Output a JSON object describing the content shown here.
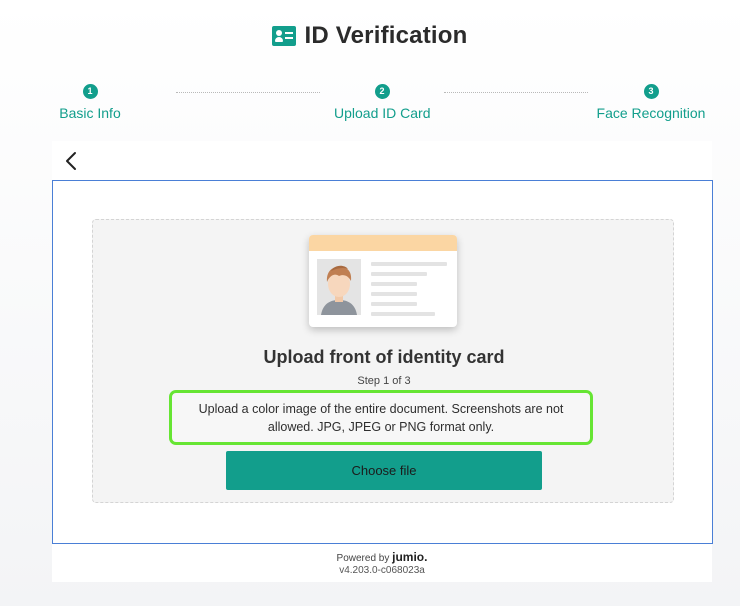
{
  "header": {
    "title": "ID Verification",
    "icon": "id-card-icon"
  },
  "stepper": {
    "steps": [
      {
        "number": "1",
        "label": "Basic Info"
      },
      {
        "number": "2",
        "label": "Upload ID Card"
      },
      {
        "number": "3",
        "label": "Face Recognition"
      }
    ]
  },
  "upload": {
    "title": "Upload front of identity card",
    "step_text": "Step 1 of 3",
    "instructions": "Upload a color image of the entire document. Screenshots are not allowed. JPG, JPEG or PNG format only.",
    "button_label": "Choose file"
  },
  "footer": {
    "powered_by": "Powered by",
    "brand": "jumio.",
    "version": "v4.203.0-c068023a"
  },
  "colors": {
    "accent": "#129e8c",
    "highlight_border": "#66e533",
    "card_border": "#4a7fd6",
    "id_card_band": "#fbd6a3"
  }
}
